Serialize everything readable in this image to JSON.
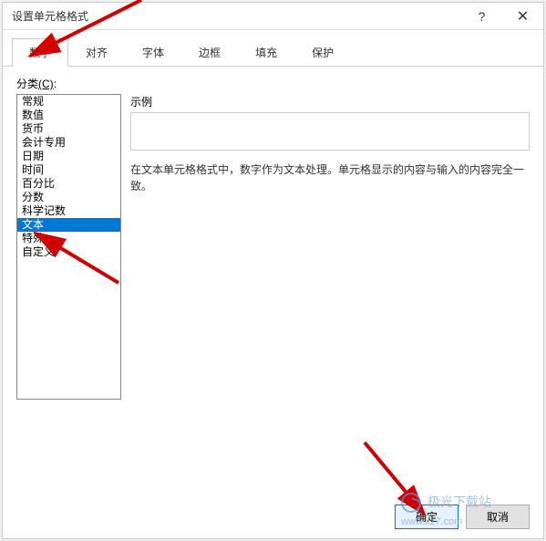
{
  "dialog": {
    "title": "设置单元格格式"
  },
  "tabs": {
    "items": [
      {
        "label": "数字"
      },
      {
        "label": "对齐"
      },
      {
        "label": "字体"
      },
      {
        "label": "边框"
      },
      {
        "label": "填充"
      },
      {
        "label": "保护"
      }
    ],
    "active_index": 0
  },
  "category": {
    "label_text": "分类",
    "label_accelerator": "(C)",
    "items": [
      "常规",
      "数值",
      "货币",
      "会计专用",
      "日期",
      "时间",
      "百分比",
      "分数",
      "科学记数",
      "文本",
      "特殊",
      "自定义"
    ],
    "selected_index": 9
  },
  "example": {
    "label": "示例",
    "value": ""
  },
  "description": "在文本单元格格式中，数字作为文本处理。单元格显示的内容与输入的内容完全一致。",
  "buttons": {
    "ok": "确定",
    "cancel": "取消"
  },
  "watermark": {
    "text": "极光下载站",
    "url": "www.xz7.com"
  }
}
